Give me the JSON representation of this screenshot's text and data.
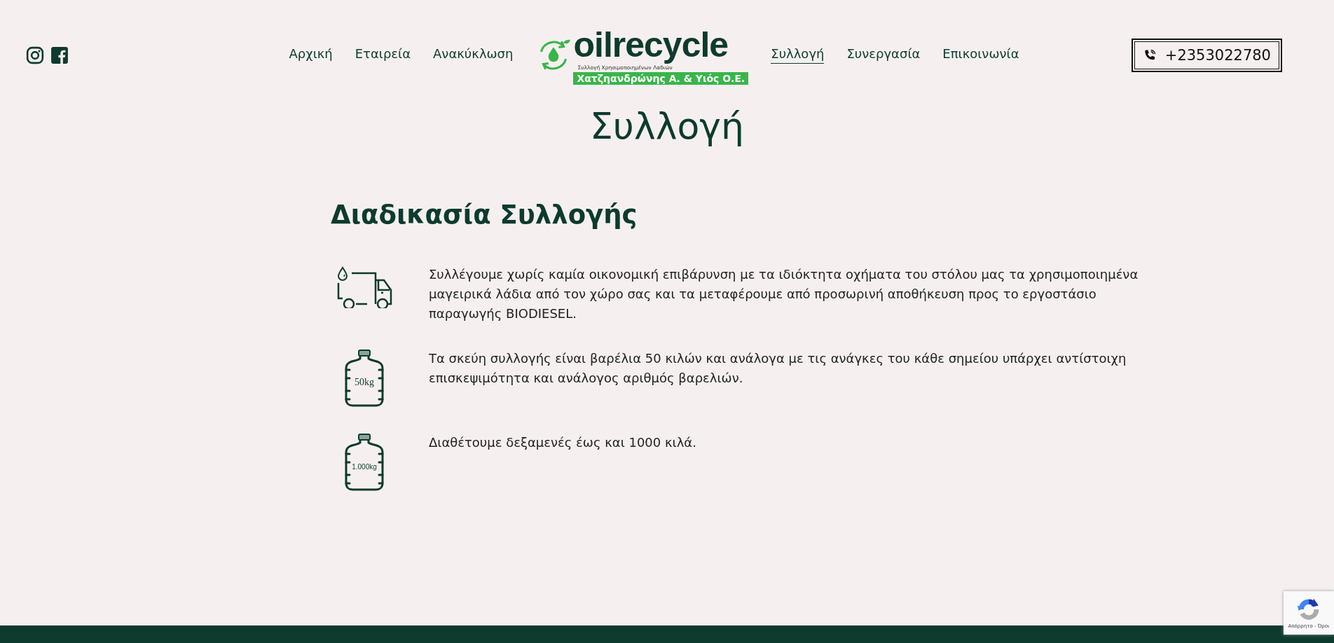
{
  "header": {
    "social": [
      {
        "kind": "instagram"
      },
      {
        "kind": "facebook"
      }
    ],
    "nav_left": [
      {
        "label": "Αρχική",
        "selected": false
      },
      {
        "label": "Εταιρεία",
        "selected": false
      },
      {
        "label": "Ανακύκλωση",
        "selected": false
      }
    ],
    "logo": {
      "name": "oilrecycle",
      "tagline": "Συλλογή Χρησιμοποιημένων Λαδιών",
      "company": "Χατζηανδρώνης Α. & Υιός Ο.Ε."
    },
    "nav_right": [
      {
        "label": "Συλλογή",
        "selected": true
      },
      {
        "label": "Συνεργασία",
        "selected": false
      },
      {
        "label": "Επικοινωνία",
        "selected": false
      }
    ],
    "phone": "+2353022780"
  },
  "page_title": "Συλλογή",
  "section_heading": "Διαδικασία Συλλογής",
  "items": [
    {
      "kind": "truck",
      "text": "Συλλέγουμε χωρίς καμία οικονομική επιβάρυνση με τα ιδιόκτητα οχήματα του στόλου μας τα χρησιμοποιημένα μαγειρικά λάδια από τον χώρο σας και τα μεταφέρουμε από προσωρινή αποθήκευση προς το εργοστάσιο παραγωγής BIODIESEL."
    },
    {
      "kind": "bottle",
      "label": "50kg",
      "text": "Τα σκεύη συλλογής είναι βαρέλια 50 κιλών και ανάλογα με τις ανάγκες του κάθε σημείου υπάρχει αντίστοιχη επισκεψιμότητα και ανάλογος αριθμός βαρελιών."
    },
    {
      "kind": "bottle",
      "label": "1.000kg",
      "text": "Διαθέτουμε δεξαμενές έως και 1000 κιλά."
    }
  ],
  "recaptcha": {
    "links": "Απόρρητο - Όροι"
  }
}
